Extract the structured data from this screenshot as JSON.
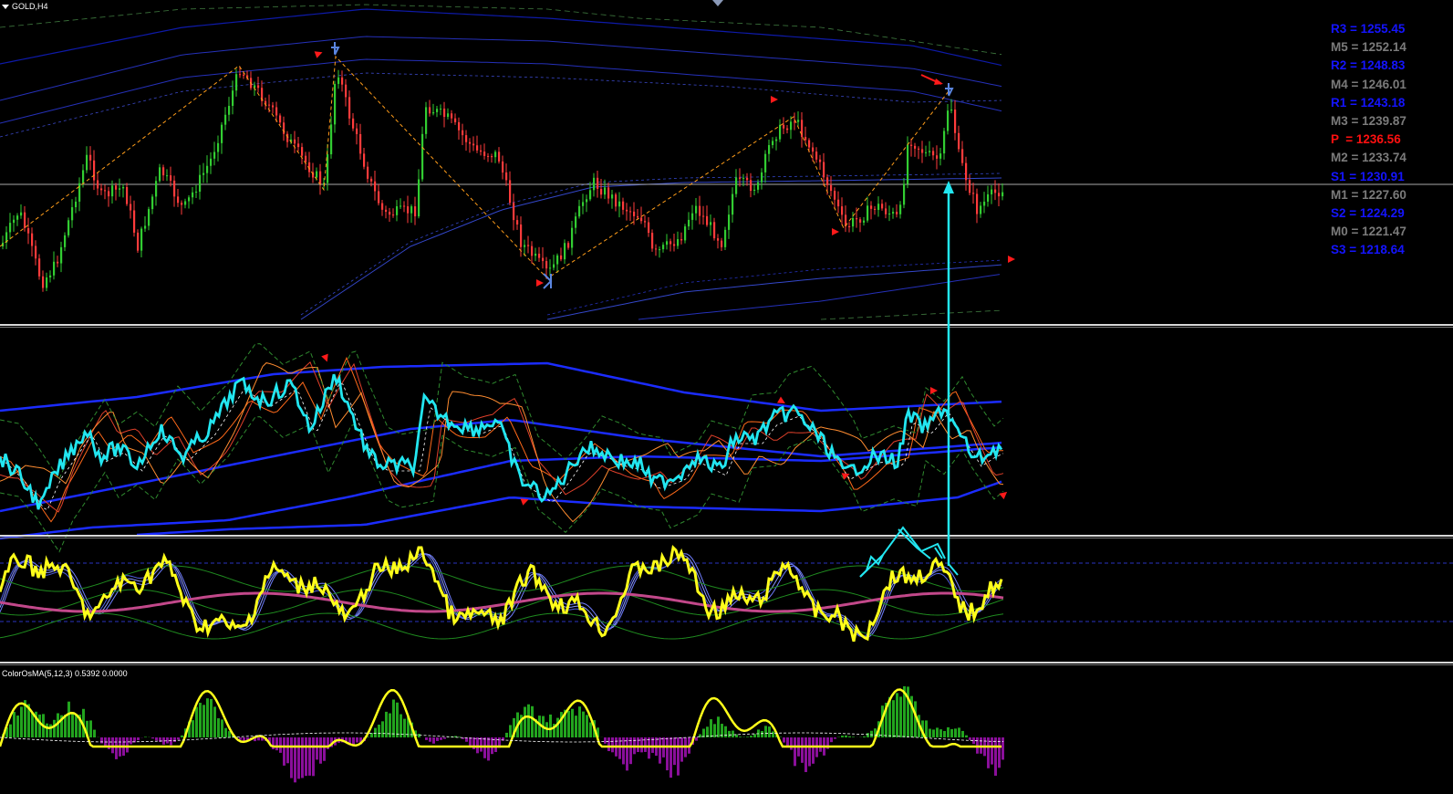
{
  "header": {
    "symbol": "GOLD,H4",
    "menu_icon": "dropdown-triangle-icon"
  },
  "osma": {
    "label": "ColorOsMA(5,12,3) 0.5392 0.0000"
  },
  "pivot_levels": [
    {
      "label": "R3 = 1255.45",
      "color": "#1414ff"
    },
    {
      "label": "M5 = 1252.14",
      "color": "#7b7b7b"
    },
    {
      "label": "R2 = 1248.83",
      "color": "#1414ff"
    },
    {
      "label": "M4 = 1246.01",
      "color": "#7b7b7b"
    },
    {
      "label": "R1 = 1243.18",
      "color": "#1414ff"
    },
    {
      "label": "M3 = 1239.87",
      "color": "#7b7b7b"
    },
    {
      "label": "P  = 1236.56",
      "color": "#ff1010"
    },
    {
      "label": "M2 = 1233.74",
      "color": "#7b7b7b"
    },
    {
      "label": "S1 = 1230.91",
      "color": "#1414ff"
    },
    {
      "label": "M1 = 1227.60",
      "color": "#7b7b7b"
    },
    {
      "label": "S2 = 1224.29",
      "color": "#1414ff"
    },
    {
      "label": "M0 = 1221.47",
      "color": "#7b7b7b"
    },
    {
      "label": "S3 = 1218.64",
      "color": "#1414ff"
    }
  ],
  "colors": {
    "background": "#000000",
    "bull_candle": "#32cd32",
    "bear_candle": "#ff3b3b",
    "cyan": "#22e6f0",
    "yellow": "#ffff1a",
    "band_blue": "#1f2cff",
    "osma_up": "#22a41e",
    "osma_down": "#8a0f9a"
  }
}
